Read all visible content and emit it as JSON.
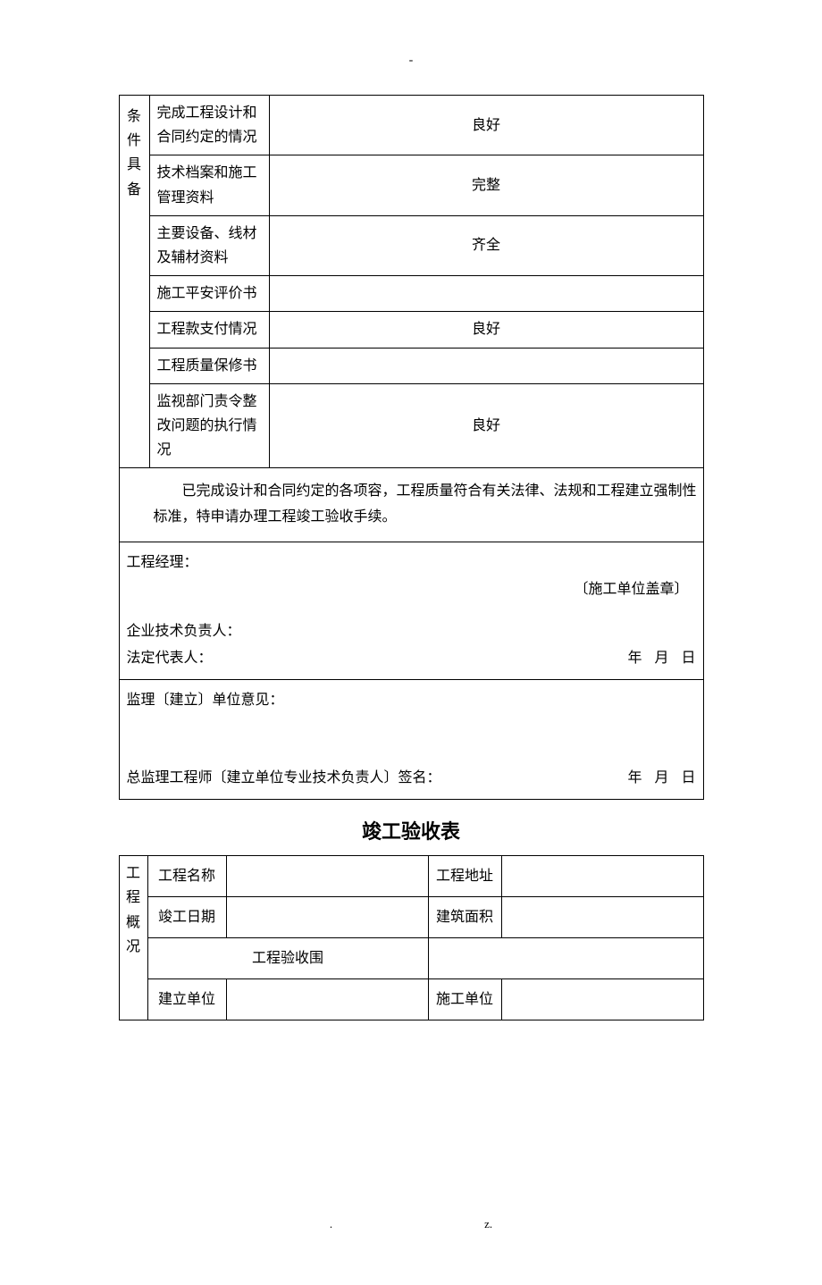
{
  "header_dash": "-",
  "conditions_section_label": "条件具备",
  "conditions": [
    {
      "label": "完成工程设计和合同约定的情况",
      "value": "良好"
    },
    {
      "label": "技术档案和施工管理资料",
      "value": "完整"
    },
    {
      "label": "主要设备、线材及辅材资料",
      "value": "齐全"
    },
    {
      "label": "施工平安评价书",
      "value": ""
    },
    {
      "label": "工程款支付情况",
      "value": "良好"
    },
    {
      "label": "工程质量保修书",
      "value": ""
    },
    {
      "label": "监视部门责令整改问题的执行情况",
      "value": "良好"
    }
  ],
  "statement": "已完成设计和合同约定的各项容，工程质量符合有关法律、法规和工程建立强制性标准，特申请办理工程竣工验收手续。",
  "sig1": {
    "pm_label": "工程经理：",
    "stamp_note": "〔施工单位盖章〕",
    "tech_label": "企业技术负责人：",
    "legal_label": "法定代表人：",
    "year": "年",
    "month": "月",
    "day": "日"
  },
  "sig2": {
    "opinion_label": "监理〔建立〕单位意见：",
    "sign_label": "总监理工程师〔建立单位专业技术负责人〕签名：",
    "year": "年",
    "month": "月",
    "day": "日"
  },
  "section2_title": "竣工验收表",
  "overview_label": "工程概况",
  "t2": {
    "r1": {
      "l1": "工程名称",
      "v1": "",
      "l2": "工程地址",
      "v2": ""
    },
    "r2": {
      "l1": "竣工日期",
      "v1": "",
      "l2": "建筑面积",
      "v2": ""
    },
    "r3": {
      "l1": "工程验收围",
      "v1": ""
    },
    "r4": {
      "l1": "建立单位",
      "v1": "",
      "l2": "施工单位",
      "v2": ""
    }
  },
  "footer": {
    "dot": ".",
    "z": "z."
  }
}
